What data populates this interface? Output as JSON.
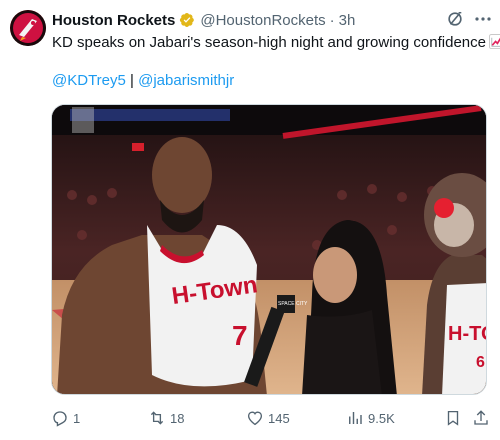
{
  "tweet": {
    "author_name": "Houston Rockets",
    "handle": "@HoustonRockets",
    "separator": "·",
    "time": "3h",
    "text": "KD speaks on Jabari's season-high night and growing confidence",
    "text_emoji": "chart-increasing-icon",
    "mention_1": "@KDTrey5",
    "mention_sep": "|",
    "mention_2": "@jabarismithjr"
  },
  "media": {
    "jersey_text": "H-Town",
    "jersey_number": "7",
    "mic_flag": "SPACE CITY",
    "mascot_jersey": "H-TO",
    "mascot_number": "6"
  },
  "actions": {
    "replies": "1",
    "reposts": "18",
    "likes": "145",
    "views": "9.5K"
  },
  "colors": {
    "link": "#1d9bf0",
    "secondary": "#536471",
    "verified_gold": "#e2b719",
    "rockets_red": "#ce1141"
  }
}
